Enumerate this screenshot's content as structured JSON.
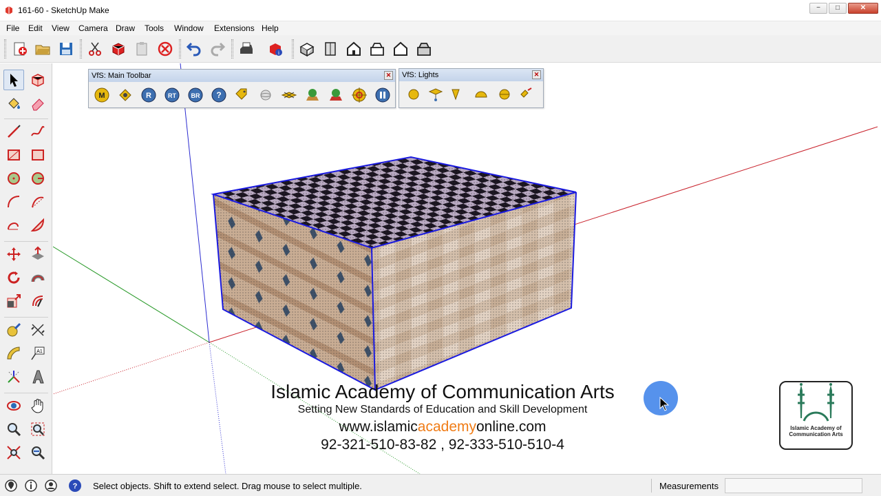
{
  "window": {
    "title": "161-60 - SketchUp Make",
    "minimize_label": "−",
    "maximize_label": "□",
    "close_label": "✕"
  },
  "menu": [
    "File",
    "Edit",
    "View",
    "Camera",
    "Draw",
    "Tools",
    "Window",
    "Extensions",
    "Help"
  ],
  "toolbar": {
    "icons": [
      "new-model-icon",
      "open-icon",
      "save-icon",
      "cut-icon",
      "copy-icon",
      "paste-icon",
      "erase-icon",
      "undo-icon",
      "redo-icon",
      "print-icon",
      "model-info-icon",
      "iso-view-icon",
      "top-view-icon",
      "front-view-icon",
      "right-view-icon",
      "back-view-icon",
      "left-view-icon"
    ]
  },
  "vfs_main_toolbar": {
    "title": "VfS: Main Toolbar",
    "close_label": "✕",
    "buttons": [
      {
        "icon": "material-icon",
        "label": "M"
      },
      {
        "icon": "options-icon",
        "label": ""
      },
      {
        "icon": "render-icon",
        "label": "R"
      },
      {
        "icon": "render-track-icon",
        "label": "RT"
      },
      {
        "icon": "batch-render-icon",
        "label": "BR"
      },
      {
        "icon": "help-icon",
        "label": "?"
      },
      {
        "icon": "tag-icon",
        "label": ""
      },
      {
        "icon": "sphere-icon",
        "label": ""
      },
      {
        "icon": "plane-icon",
        "label": ""
      },
      {
        "icon": "tree-icon",
        "label": ""
      },
      {
        "icon": "tree-alt-icon",
        "label": ""
      },
      {
        "icon": "target-icon",
        "label": ""
      },
      {
        "icon": "pause-icon",
        "label": ""
      }
    ]
  },
  "vfs_lights": {
    "title": "VfS: Lights",
    "close_label": "✕",
    "buttons": [
      "omni-light-icon",
      "rect-light-icon",
      "spot-light-icon",
      "ies-light-icon",
      "sphere-light-icon",
      "light-edit-icon"
    ]
  },
  "palette": {
    "tools": [
      "select-icon",
      "make-component-icon",
      "paint-bucket-icon",
      "eraser-icon",
      "line-icon",
      "freehand-icon",
      "rectangle-icon",
      "rotated-rectangle-icon",
      "circle-icon",
      "polygon-icon",
      "arc-icon",
      "two-point-arc-icon",
      "three-point-arc-icon",
      "pie-icon",
      "move-icon",
      "push-pull-icon",
      "rotate-icon",
      "follow-me-icon",
      "scale-icon",
      "offset-icon",
      "tape-measure-icon",
      "dimension-icon",
      "protractor-icon",
      "text-icon",
      "axes-icon",
      "3d-text-icon",
      "orbit-icon",
      "pan-icon",
      "zoom-icon",
      "zoom-window-icon",
      "zoom-extents-icon",
      "previous-view-icon"
    ]
  },
  "watermark": {
    "title": "Islamic Academy of Communication Arts",
    "subtitle": "Setting New Standards of Education and Skill Development",
    "url_prefix": "www.islamic",
    "url_highlight": "academy",
    "url_suffix": "online.com",
    "phones": "92-321-510-83-82  ,  92-333-510-510-4",
    "logo_text": "Islamic Academy of Communication Arts"
  },
  "statusbar": {
    "hint": "Select objects. Shift to extend select. Drag mouse to select multiple.",
    "measurements_label": "Measurements",
    "measurements_value": ""
  },
  "colors": {
    "red_axis": "#c8202a",
    "green_axis": "#2a9a2a",
    "blue_axis": "#2a2ad0",
    "selection": "#1a1ae0",
    "accent": "#f07c16"
  }
}
